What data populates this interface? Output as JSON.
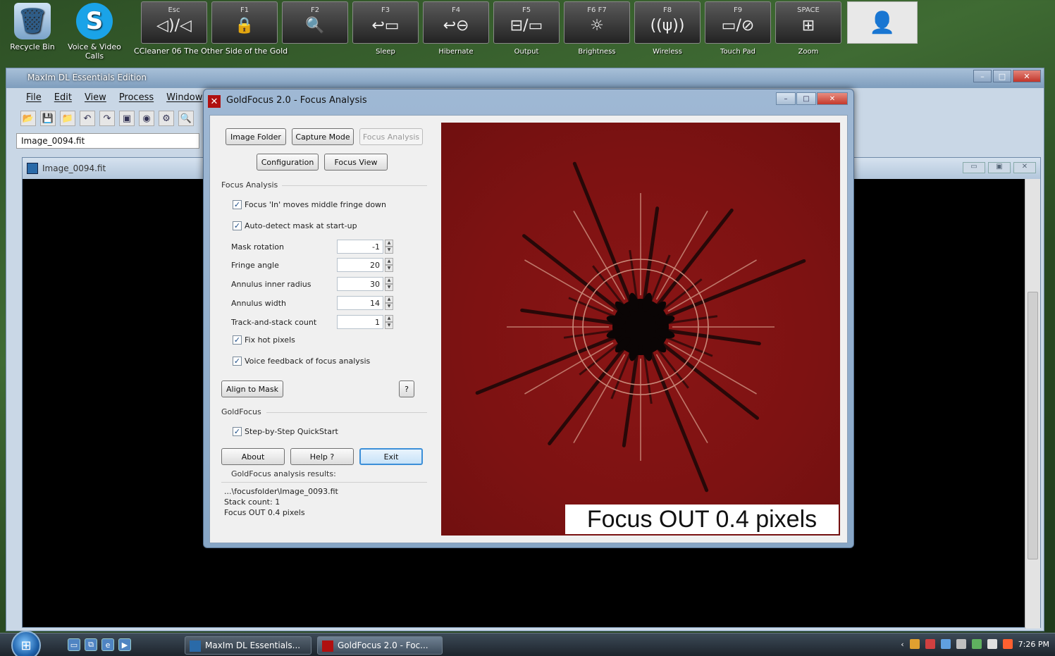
{
  "desktop": {
    "icons": [
      {
        "label": "Recycle Bin",
        "glyph": "🗑"
      },
      {
        "label": "Voice & Video Calls",
        "glyph": "S"
      }
    ],
    "ccleaner_label": "CCleaner",
    "ccleaner_extra": "06 The Other Side of the",
    "ccleaner_extra2": "Gold"
  },
  "keys": [
    {
      "top": "Esc",
      "symbol": "◁)/◁",
      "caption": ""
    },
    {
      "top": "F1",
      "symbol": "🔒",
      "caption": ""
    },
    {
      "top": "F2",
      "symbol": "🔍",
      "caption": ""
    },
    {
      "top": "F3",
      "symbol": "↩▭",
      "caption": "Sleep"
    },
    {
      "top": "F4",
      "symbol": "↩⊖",
      "caption": "Hibernate"
    },
    {
      "top": "F5",
      "symbol": "⊟/▭",
      "caption": "Output"
    },
    {
      "top": "F6   F7",
      "symbol": "☼",
      "caption": "Brightness"
    },
    {
      "top": "F8",
      "symbol": "((ψ))",
      "caption": "Wireless"
    },
    {
      "top": "F9",
      "symbol": "▭/⊘",
      "caption": "Touch Pad"
    },
    {
      "top": "SPACE",
      "symbol": "⊞",
      "caption": "Zoom"
    }
  ],
  "main": {
    "title": "MaxIm DL Essentials Edition",
    "menu": [
      "File",
      "Edit",
      "View",
      "Process",
      "Window"
    ],
    "file_field": "Image_0094.fit",
    "child_title": "Image_0094.fit"
  },
  "dialog": {
    "title": "GoldFocus 2.0 - Focus Analysis",
    "buttons": {
      "image_folder": "Image Folder",
      "capture_mode": "Capture Mode",
      "focus_analysis": "Focus Analysis",
      "configuration": "Configuration",
      "focus_view": "Focus View",
      "align_to_mask": "Align to Mask",
      "help_q": "?",
      "about": "About",
      "help": "Help ?",
      "exit": "Exit"
    },
    "focus_group_label": "Focus Analysis",
    "checks": {
      "focus_in": "Focus 'In' moves middle fringe down",
      "auto_detect": "Auto-detect mask at start-up",
      "fix_hot": "Fix hot pixels",
      "voice": "Voice feedback of focus analysis",
      "quickstart": "Step-by-Step QuickStart"
    },
    "fields": [
      {
        "label": "Mask rotation",
        "value": "-1"
      },
      {
        "label": "Fringe angle",
        "value": "20"
      },
      {
        "label": "Annulus inner radius",
        "value": "30"
      },
      {
        "label": "Annulus width",
        "value": "14"
      },
      {
        "label": "Track-and-stack count",
        "value": "1"
      }
    ],
    "goldfocus_group_label": "GoldFocus",
    "results_label": "GoldFocus analysis results:",
    "results": [
      "...\\focusfolder\\Image_0093.fit",
      "Stack count: 1",
      "Focus OUT 0.4 pixels"
    ],
    "image_caption": "Focus OUT 0.4 pixels"
  },
  "taskbar": {
    "tasks": [
      "MaxIm DL Essentials...",
      "GoldFocus 2.0 - Foc..."
    ],
    "clock": "7:26 PM"
  },
  "colors": {
    "image_bg": "#7d1212",
    "ring": "#c98a7a",
    "star": "#0a0505"
  }
}
